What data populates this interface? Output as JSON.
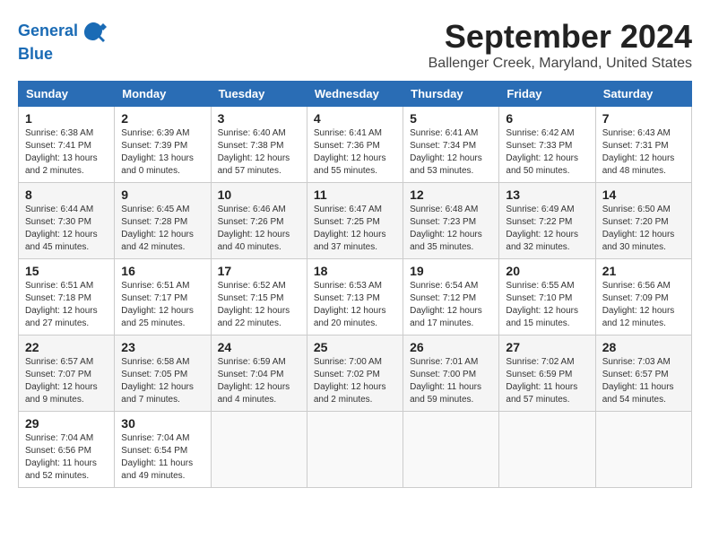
{
  "logo": {
    "line1": "General",
    "line2": "Blue"
  },
  "title": "September 2024",
  "location": "Ballenger Creek, Maryland, United States",
  "headers": [
    "Sunday",
    "Monday",
    "Tuesday",
    "Wednesday",
    "Thursday",
    "Friday",
    "Saturday"
  ],
  "weeks": [
    [
      {
        "day": "1",
        "sunrise": "6:38 AM",
        "sunset": "7:41 PM",
        "daylight": "13 hours and 2 minutes."
      },
      {
        "day": "2",
        "sunrise": "6:39 AM",
        "sunset": "7:39 PM",
        "daylight": "13 hours and 0 minutes."
      },
      {
        "day": "3",
        "sunrise": "6:40 AM",
        "sunset": "7:38 PM",
        "daylight": "12 hours and 57 minutes."
      },
      {
        "day": "4",
        "sunrise": "6:41 AM",
        "sunset": "7:36 PM",
        "daylight": "12 hours and 55 minutes."
      },
      {
        "day": "5",
        "sunrise": "6:41 AM",
        "sunset": "7:34 PM",
        "daylight": "12 hours and 53 minutes."
      },
      {
        "day": "6",
        "sunrise": "6:42 AM",
        "sunset": "7:33 PM",
        "daylight": "12 hours and 50 minutes."
      },
      {
        "day": "7",
        "sunrise": "6:43 AM",
        "sunset": "7:31 PM",
        "daylight": "12 hours and 48 minutes."
      }
    ],
    [
      {
        "day": "8",
        "sunrise": "6:44 AM",
        "sunset": "7:30 PM",
        "daylight": "12 hours and 45 minutes."
      },
      {
        "day": "9",
        "sunrise": "6:45 AM",
        "sunset": "7:28 PM",
        "daylight": "12 hours and 42 minutes."
      },
      {
        "day": "10",
        "sunrise": "6:46 AM",
        "sunset": "7:26 PM",
        "daylight": "12 hours and 40 minutes."
      },
      {
        "day": "11",
        "sunrise": "6:47 AM",
        "sunset": "7:25 PM",
        "daylight": "12 hours and 37 minutes."
      },
      {
        "day": "12",
        "sunrise": "6:48 AM",
        "sunset": "7:23 PM",
        "daylight": "12 hours and 35 minutes."
      },
      {
        "day": "13",
        "sunrise": "6:49 AM",
        "sunset": "7:22 PM",
        "daylight": "12 hours and 32 minutes."
      },
      {
        "day": "14",
        "sunrise": "6:50 AM",
        "sunset": "7:20 PM",
        "daylight": "12 hours and 30 minutes."
      }
    ],
    [
      {
        "day": "15",
        "sunrise": "6:51 AM",
        "sunset": "7:18 PM",
        "daylight": "12 hours and 27 minutes."
      },
      {
        "day": "16",
        "sunrise": "6:51 AM",
        "sunset": "7:17 PM",
        "daylight": "12 hours and 25 minutes."
      },
      {
        "day": "17",
        "sunrise": "6:52 AM",
        "sunset": "7:15 PM",
        "daylight": "12 hours and 22 minutes."
      },
      {
        "day": "18",
        "sunrise": "6:53 AM",
        "sunset": "7:13 PM",
        "daylight": "12 hours and 20 minutes."
      },
      {
        "day": "19",
        "sunrise": "6:54 AM",
        "sunset": "7:12 PM",
        "daylight": "12 hours and 17 minutes."
      },
      {
        "day": "20",
        "sunrise": "6:55 AM",
        "sunset": "7:10 PM",
        "daylight": "12 hours and 15 minutes."
      },
      {
        "day": "21",
        "sunrise": "6:56 AM",
        "sunset": "7:09 PM",
        "daylight": "12 hours and 12 minutes."
      }
    ],
    [
      {
        "day": "22",
        "sunrise": "6:57 AM",
        "sunset": "7:07 PM",
        "daylight": "12 hours and 9 minutes."
      },
      {
        "day": "23",
        "sunrise": "6:58 AM",
        "sunset": "7:05 PM",
        "daylight": "12 hours and 7 minutes."
      },
      {
        "day": "24",
        "sunrise": "6:59 AM",
        "sunset": "7:04 PM",
        "daylight": "12 hours and 4 minutes."
      },
      {
        "day": "25",
        "sunrise": "7:00 AM",
        "sunset": "7:02 PM",
        "daylight": "12 hours and 2 minutes."
      },
      {
        "day": "26",
        "sunrise": "7:01 AM",
        "sunset": "7:00 PM",
        "daylight": "11 hours and 59 minutes."
      },
      {
        "day": "27",
        "sunrise": "7:02 AM",
        "sunset": "6:59 PM",
        "daylight": "11 hours and 57 minutes."
      },
      {
        "day": "28",
        "sunrise": "7:03 AM",
        "sunset": "6:57 PM",
        "daylight": "11 hours and 54 minutes."
      }
    ],
    [
      {
        "day": "29",
        "sunrise": "7:04 AM",
        "sunset": "6:56 PM",
        "daylight": "11 hours and 52 minutes."
      },
      {
        "day": "30",
        "sunrise": "7:04 AM",
        "sunset": "6:54 PM",
        "daylight": "11 hours and 49 minutes."
      },
      null,
      null,
      null,
      null,
      null
    ]
  ]
}
